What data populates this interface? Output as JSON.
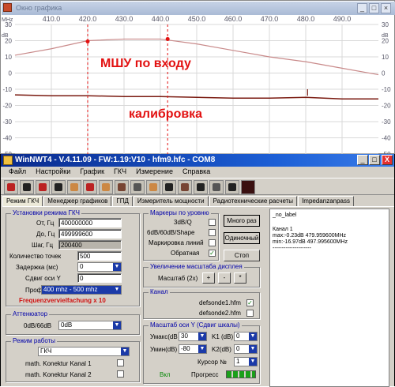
{
  "graph_window": {
    "title": "Окно графика",
    "min_label": "_",
    "max_label": "□",
    "close_label": "×",
    "x_axis_unit": "MHz",
    "y_axis_unit": "dB",
    "x_ticks": [
      "410.0",
      "420.0",
      "430.0",
      "440.0",
      "450.0",
      "460.0",
      "470.0",
      "480.0",
      "490.0"
    ],
    "y_ticks": [
      "30",
      "20",
      "10",
      "0",
      "-10",
      "-20",
      "-30",
      "-40",
      "-50"
    ],
    "annotation_top": "МШУ по входу",
    "annotation_bottom": "калибровка",
    "colors": {
      "trace_top": "#c98a8a",
      "trace_bottom": "#7a1a10",
      "marker": "#e21010"
    }
  },
  "chart_data": {
    "type": "line",
    "xlabel": "MHz",
    "ylabel": "dB",
    "xlim": [
      400,
      500
    ],
    "ylim": [
      -50,
      30
    ],
    "x_ticks": [
      410,
      420,
      430,
      440,
      450,
      460,
      470,
      480,
      490
    ],
    "y_ticks": [
      30,
      20,
      10,
      0,
      -10,
      -20,
      -30,
      -40,
      -50
    ],
    "grid": true,
    "series": [
      {
        "x": [
          400,
          410,
          420,
          430,
          440,
          450,
          460,
          470,
          480,
          490,
          500
        ],
        "y": [
          11,
          15,
          20,
          21,
          21,
          18,
          14,
          10,
          7,
          3,
          -1
        ]
      },
      {
        "x": [
          400,
          410,
          420,
          430,
          440,
          450,
          460,
          470,
          480,
          490,
          500
        ],
        "y": [
          -13.5,
          -14,
          -14,
          -14.5,
          -14.5,
          -15,
          -15.5,
          -15.5,
          -15,
          -16,
          -16
        ]
      }
    ],
    "markers": [
      {
        "x": 420,
        "y": 19.5
      },
      {
        "x": 442,
        "y": 21
      }
    ]
  },
  "main_window": {
    "title": "WinNWT4 - V.4.11.09 - FW:1.19:V10 - hfm9.hfc - COM8",
    "min_label": "_",
    "max_label": "□",
    "close_label": "X",
    "menu": [
      "Файл",
      "Настройки",
      "График",
      "ГКЧ",
      "Измерение",
      "Справка"
    ],
    "tabs": [
      "Режим ГКЧ",
      "Менеджер графиков",
      "ГПД",
      "Измеритель мощности",
      "Радиотехнические расчеты",
      "Impedanzanpass"
    ],
    "setup": {
      "title": "Установки режима ГКЧ",
      "from_label": "От, Гц",
      "from_value": "400000000",
      "to_label": "До, Гц",
      "to_value": "499999600",
      "step_label": "Шаг, Гц",
      "step_value": "200400",
      "points_label": "Количество точек",
      "points_value": "500",
      "delay_label": "Задержка (мс)",
      "delay_value": "0",
      "yshift_label": "Сдвиг оси Y",
      "yshift_value": "0",
      "prof_label": "Проф",
      "prof_value": "400 mhz - 500 mhz",
      "multiplier_text": "Frequenzvervielfachung x 10"
    },
    "attenuator": {
      "title": "Аттенюатор",
      "label": "0dB/66dB",
      "value": "0dB"
    },
    "mode": {
      "title": "Режим работы",
      "value": "ГКЧ",
      "math1_label": "math. Konektur Kanal 1",
      "math2_label": "math. Konektur Kanal 2"
    },
    "markers": {
      "title": "Маркеры по уровню",
      "items": [
        {
          "label": "3dB/Q",
          "checked": ""
        },
        {
          "label": "6dB/60dB/Shape",
          "checked": ""
        },
        {
          "label": "Маркировка линий",
          "checked": ""
        },
        {
          "label": "Обратная",
          "checked": "✓"
        }
      ]
    },
    "scale": {
      "title": "Увеличение масштаба дисплея",
      "label": "Масштаб (2x)",
      "plus": "+",
      "minus": "-",
      "star": "*"
    },
    "channel": {
      "title": "Канал",
      "items": [
        {
          "label": "defsonde1.hfm",
          "checked": "✓"
        },
        {
          "label": "defsonde2.hfm",
          "checked": ""
        }
      ]
    },
    "yscale": {
      "title": "Масштаб оси Y (Сдвиг шкалы)",
      "ymax_label": "Умакс(dB",
      "ymax_value": "30",
      "ymin_label": "Умин(dB)",
      "ymin_value": "-80",
      "k1_label": "K1 (dB)",
      "k1_value": "0",
      "k2_label": "K2(dB)",
      "k2_value": "0",
      "cursor_label": "Курсор №",
      "cursor_value": "1",
      "on_label": "Вкл",
      "progress_label": "Прогресс"
    },
    "buttons": {
      "once": "Много раз",
      "single": "Одиночный",
      "stop": "Стоп"
    },
    "info": {
      "title": "_no_label",
      "channel": "Канал 1",
      "max": "max:-0.23dB 479.959600MHz",
      "min": "min:-16.97dB 497.995600MHz",
      "dashes": "---------------------"
    }
  }
}
